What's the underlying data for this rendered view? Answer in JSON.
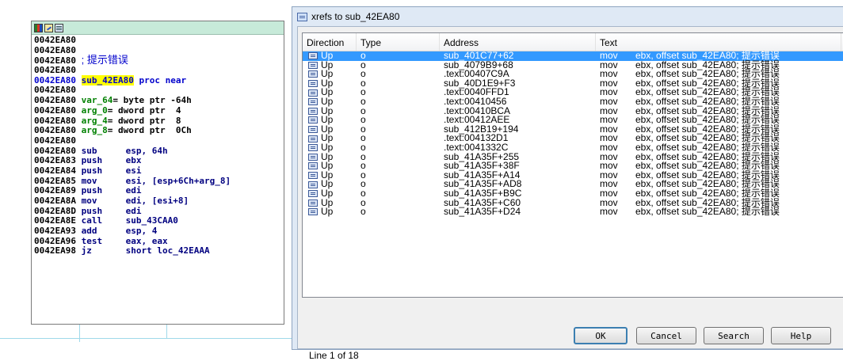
{
  "code_node": {
    "lines": [
      {
        "addr": "0042EA80",
        "text": ""
      },
      {
        "addr": "0042EA80",
        "text": ""
      },
      {
        "addr": "0042EA80",
        "comment": "; 提示错误"
      },
      {
        "addr": "0042EA80",
        "text": ""
      },
      {
        "addr": "0042EA80",
        "func": "sub_42EA80",
        "proc": " proc near",
        "highlight": true
      },
      {
        "addr": "0042EA80",
        "text": ""
      },
      {
        "addr": "0042EA80",
        "var": "var_64",
        "rest": "= byte ptr -64h"
      },
      {
        "addr": "0042EA80",
        "var": "arg_0",
        "rest": "= dword ptr  4"
      },
      {
        "addr": "0042EA80",
        "var": "arg_4",
        "rest": "= dword ptr  8"
      },
      {
        "addr": "0042EA80",
        "var": "arg_8",
        "rest": "= dword ptr  0Ch"
      },
      {
        "addr": "0042EA80",
        "text": ""
      },
      {
        "addr": "0042EA80",
        "mn": "sub",
        "ops": "esp, 64h"
      },
      {
        "addr": "0042EA83",
        "mn": "push",
        "ops": "ebx"
      },
      {
        "addr": "0042EA84",
        "mn": "push",
        "ops": "esi"
      },
      {
        "addr": "0042EA85",
        "mn": "mov",
        "ops": "esi, [esp+6Ch+arg_8]"
      },
      {
        "addr": "0042EA89",
        "mn": "push",
        "ops": "edi"
      },
      {
        "addr": "0042EA8A",
        "mn": "mov",
        "ops": "edi, [esi+8]"
      },
      {
        "addr": "0042EA8D",
        "mn": "push",
        "ops": "edi"
      },
      {
        "addr": "0042EA8E",
        "mn": "call",
        "ops": "sub_43CAA0"
      },
      {
        "addr": "0042EA93",
        "mn": "add",
        "ops": "esp, 4"
      },
      {
        "addr": "0042EA96",
        "mn": "test",
        "ops": "eax, eax"
      },
      {
        "addr": "0042EA98",
        "mn": "jz",
        "ops": "short loc_42EAAA"
      }
    ]
  },
  "dialog": {
    "title": "xrefs to sub_42EA80",
    "columns": [
      "Direction",
      "Type",
      "Address",
      "Text"
    ],
    "rows": [
      {
        "dir": "Up",
        "type": "o",
        "address": "sub_401C77+62",
        "mnem": "mov",
        "text": "ebx, offset sub_42EA80; 提示错误"
      },
      {
        "dir": "Up",
        "type": "o",
        "address": "sub_4079B9+68",
        "mnem": "mov",
        "text": "ebx, offset sub_42EA80; 提示错误"
      },
      {
        "dir": "Up",
        "type": "o",
        "address": ".text:00407C9A",
        "mnem": "mov",
        "text": "ebx, offset sub_42EA80; 提示错误"
      },
      {
        "dir": "Up",
        "type": "o",
        "address": "sub_40D1E9+F3",
        "mnem": "mov",
        "text": "ebx, offset sub_42EA80; 提示错误"
      },
      {
        "dir": "Up",
        "type": "o",
        "address": ".text:0040FFD1",
        "mnem": "mov",
        "text": "ebx, offset sub_42EA80; 提示错误"
      },
      {
        "dir": "Up",
        "type": "o",
        "address": ".text:00410456",
        "mnem": "mov",
        "text": "ebx, offset sub_42EA80; 提示错误"
      },
      {
        "dir": "Up",
        "type": "o",
        "address": ".text:00410BCA",
        "mnem": "mov",
        "text": "ebx, offset sub_42EA80; 提示错误"
      },
      {
        "dir": "Up",
        "type": "o",
        "address": ".text:00412AEE",
        "mnem": "mov",
        "text": "ebx, offset sub_42EA80; 提示错误"
      },
      {
        "dir": "Up",
        "type": "o",
        "address": "sub_412B19+194",
        "mnem": "mov",
        "text": "ebx, offset sub_42EA80; 提示错误"
      },
      {
        "dir": "Up",
        "type": "o",
        "address": ".text:004132D1",
        "mnem": "mov",
        "text": "ebx, offset sub_42EA80; 提示错误"
      },
      {
        "dir": "Up",
        "type": "o",
        "address": ".text:0041332C",
        "mnem": "mov",
        "text": "ebx, offset sub_42EA80; 提示错误"
      },
      {
        "dir": "Up",
        "type": "o",
        "address": "sub_41A35F+255",
        "mnem": "mov",
        "text": "ebx, offset sub_42EA80; 提示错误"
      },
      {
        "dir": "Up",
        "type": "o",
        "address": "sub_41A35F+38F",
        "mnem": "mov",
        "text": "ebx, offset sub_42EA80; 提示错误"
      },
      {
        "dir": "Up",
        "type": "o",
        "address": "sub_41A35F+A14",
        "mnem": "mov",
        "text": "ebx, offset sub_42EA80; 提示错误"
      },
      {
        "dir": "Up",
        "type": "o",
        "address": "sub_41A35F+AD8",
        "mnem": "mov",
        "text": "ebx, offset sub_42EA80; 提示错误"
      },
      {
        "dir": "Up",
        "type": "o",
        "address": "sub_41A35F+B9C",
        "mnem": "mov",
        "text": "ebx, offset sub_42EA80; 提示错误"
      },
      {
        "dir": "Up",
        "type": "o",
        "address": "sub_41A35F+C60",
        "mnem": "mov",
        "text": "ebx, offset sub_42EA80; 提示错误"
      },
      {
        "dir": "Up",
        "type": "o",
        "address": "sub_41A35F+D24",
        "mnem": "mov",
        "text": "ebx, offset sub_42EA80; 提示错误"
      }
    ],
    "selected_row": 0,
    "buttons": {
      "ok": "OK",
      "cancel": "Cancel",
      "search": "Search",
      "help": "Help"
    },
    "status": "Line 1 of 18"
  },
  "colors": {
    "selection": "#3399ff",
    "title_bar": "#c7ead9",
    "function_highlight": "#ffff00",
    "dialog_frame": "#dfe9f5"
  }
}
